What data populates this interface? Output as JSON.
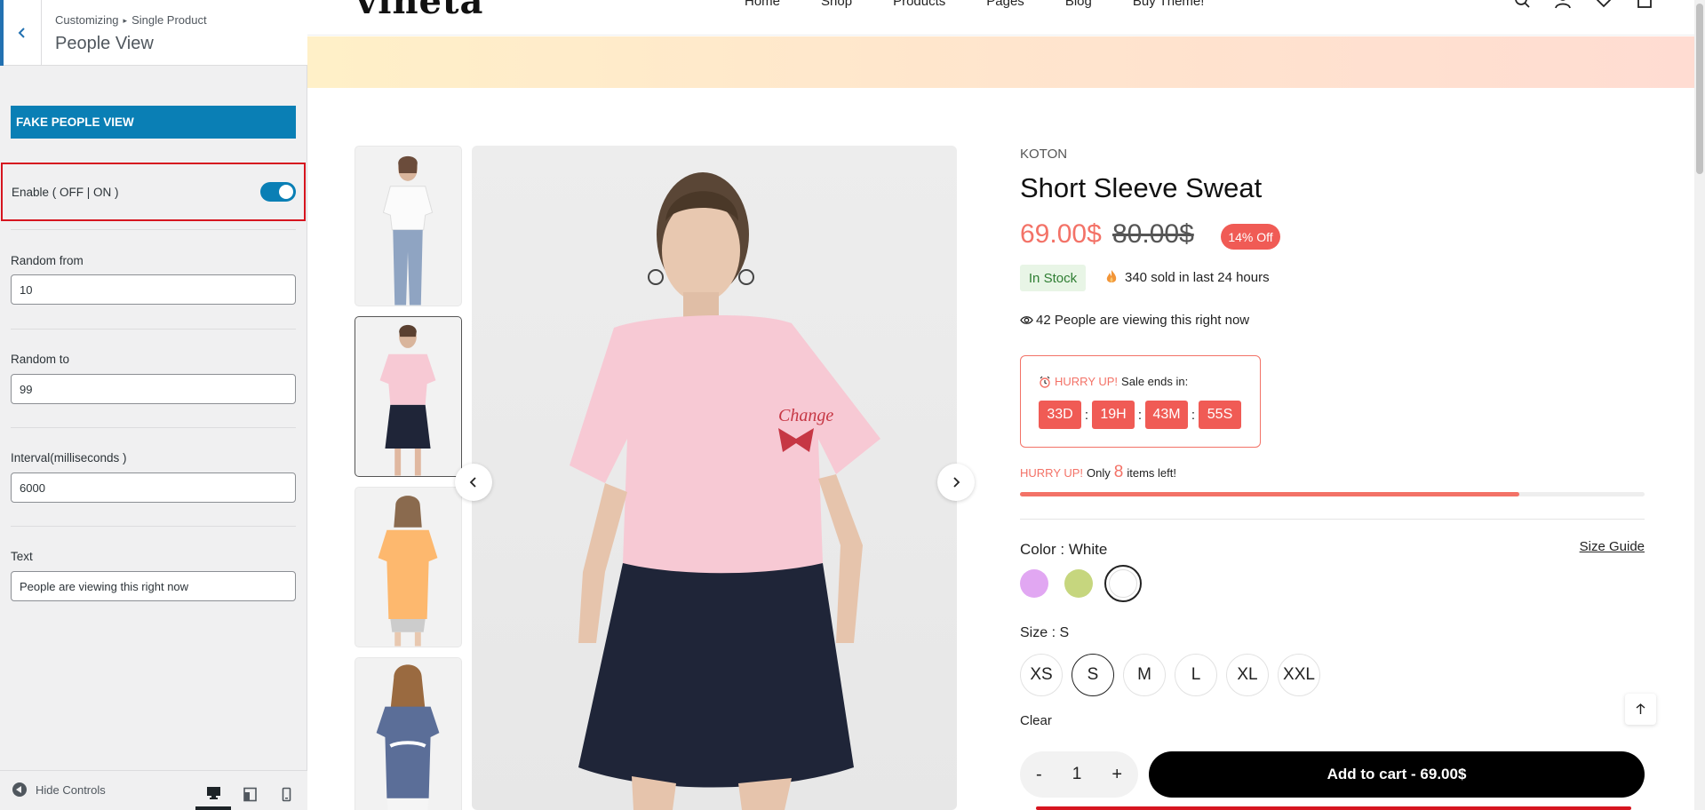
{
  "sidebar": {
    "breadcrumb_root": "Customizing",
    "breadcrumb_parent": "Single Product",
    "title": "People View",
    "section_title": "FAKE PEOPLE VIEW",
    "enable_label": "Enable ( OFF | ON )",
    "enable_on": true,
    "fields": {
      "random_from_label": "Random from",
      "random_from_value": "10",
      "random_to_label": "Random to",
      "random_to_value": "99",
      "interval_label": "Interval(milliseconds )",
      "interval_value": "6000",
      "text_label": "Text",
      "text_value": "People are viewing this right now"
    },
    "hide_controls": "Hide Controls"
  },
  "header": {
    "logo": "vineta",
    "nav": [
      "Home",
      "Shop",
      "Products",
      "Pages",
      "Blog",
      "Buy Theme!"
    ]
  },
  "product": {
    "brand": "KOTON",
    "title": "Short Sleeve Sweat",
    "price": "69.00$",
    "old_price": "80.00$",
    "discount": "14% Off",
    "stock": "In Stock",
    "sold_text": "340 sold in last 24 hours",
    "viewing_text": "42 People are viewing this right now",
    "timer_hurry": "HURRY UP!",
    "timer_text": "Sale ends in:",
    "timer": {
      "days": "33D",
      "hours": "19H",
      "minutes": "43M",
      "seconds": "55S"
    },
    "items_hurry": "HURRY UP!",
    "items_only": "Only",
    "items_count": "8",
    "items_suffix": "items left!",
    "stock_level": 0.8,
    "color_label": "Color :",
    "color_value": "White",
    "size_guide": "Size Guide",
    "swatches": [
      "#e1a7f2",
      "#c6d67e",
      "#ffffff"
    ],
    "size_label": "Size :",
    "size_value": "S",
    "sizes": [
      "XS",
      "S",
      "M",
      "L",
      "XL",
      "XXL"
    ],
    "clear": "Clear",
    "qty_minus": "-",
    "qty_value": "1",
    "qty_plus": "+",
    "add_to_cart": "Add to cart - 69.00$"
  },
  "colors": {
    "accent": "#0a7fb5",
    "sale": "#f37267",
    "highlight_border": "#d6151f"
  }
}
